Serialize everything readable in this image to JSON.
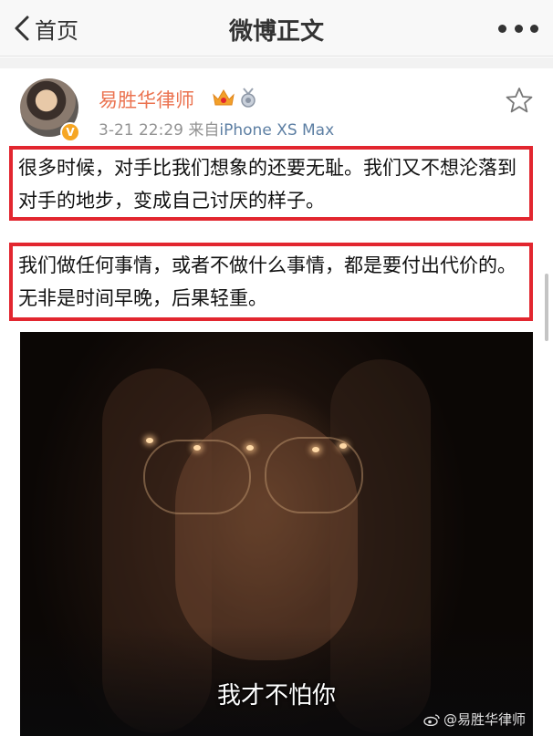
{
  "nav": {
    "back_label": "首页",
    "title": "微博正文"
  },
  "post": {
    "author": "易胜华律师",
    "time": "3-21 22:29",
    "source_prefix": "来自",
    "source": "iPhone XS Max",
    "paragraphs": [
      "很多时候，对手比我们想象的还要无耻。我们又不想沦落到对手的地步，变成自己讨厌的样子。",
      "我们做任何事情，或者不做什么事情，都是要付出代价的。无非是时间早晚，后果轻重。"
    ],
    "image": {
      "subtitle": "我才不怕你",
      "watermark": "@易胜华律师"
    }
  },
  "colors": {
    "username": "#eb7350",
    "source_link": "#5d7fa3",
    "highlight_border": "#e2262f",
    "verified_badge": "#f6a623"
  },
  "icons": [
    "back-chevron-icon",
    "more-dots-icon",
    "crown-icon",
    "medal-icon",
    "verified-v-icon",
    "star-icon",
    "weibo-logo-icon"
  ]
}
